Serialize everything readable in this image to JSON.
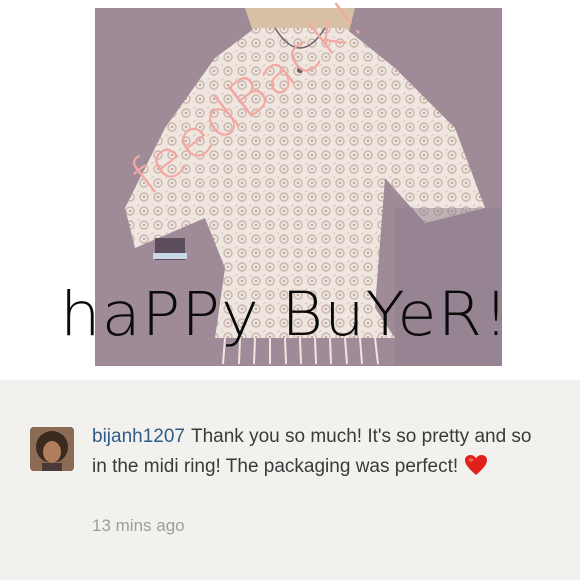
{
  "photo": {
    "overlay_feedback": "feedBack!",
    "overlay_happy_buyer": "haPPy BuYeR!"
  },
  "comment": {
    "username": "bijanh1207",
    "text": "Thank you so much! It's so pretty and so in the midi ring! The packaging was perfect!",
    "emoji_icon": "red-heart-icon",
    "timestamp": "13 mins ago"
  },
  "colors": {
    "username": "#2f5c87",
    "feedback_overlay": "#f4a6a0",
    "comment_bg": "#f2f1ed",
    "heart": "#e0201b"
  }
}
